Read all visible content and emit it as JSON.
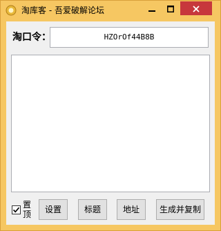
{
  "window": {
    "title": "淘库客 - 吾爱破解论坛"
  },
  "form": {
    "code_label": "淘口令：",
    "code_value": "HZOrOf44B8B",
    "output_text": ""
  },
  "toolbar": {
    "pin_label": "置顶",
    "pin_checked": true,
    "settings_label": "设置",
    "title_label": "标题",
    "address_label": "地址",
    "generate_label": "生成并复制"
  },
  "colors": {
    "frame": "#f6c762",
    "close_button": "#c7383c",
    "client_bg": "#f0f0f0"
  },
  "icons": [
    "app-icon",
    "minimize-icon",
    "maximize-icon",
    "close-icon",
    "checkmark-icon"
  ]
}
